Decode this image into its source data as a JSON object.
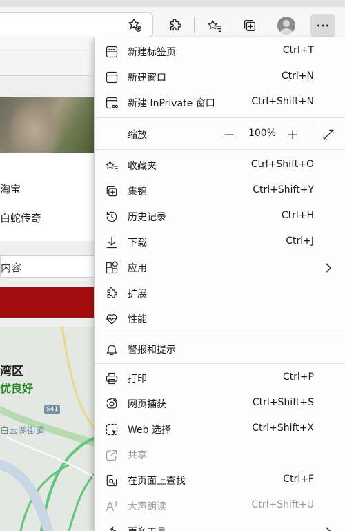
{
  "toolbar": {
    "icons": [
      "add-favorite-icon",
      "extensions-icon",
      "favorites-icon",
      "collections-icon",
      "profile-icon",
      "more-icon"
    ]
  },
  "page": {
    "line1": "淘宝",
    "line2": "白蛇传奇",
    "search_text": "内容",
    "map_title": "湾区",
    "map_status": "优良好",
    "map_road": "白云湖街道",
    "map_badge": "S41"
  },
  "menu": {
    "new_tab": {
      "label": "新建标签页",
      "shortcut": "Ctrl+T"
    },
    "new_window": {
      "label": "新建窗口",
      "shortcut": "Ctrl+N"
    },
    "new_inprivate": {
      "label": "新建 InPrivate 窗口",
      "shortcut": "Ctrl+Shift+N"
    },
    "zoom": {
      "label": "缩放",
      "value": "100%"
    },
    "favorites": {
      "label": "收藏夹",
      "shortcut": "Ctrl+Shift+O"
    },
    "collections": {
      "label": "集锦",
      "shortcut": "Ctrl+Shift+Y"
    },
    "history": {
      "label": "历史记录",
      "shortcut": "Ctrl+H"
    },
    "downloads": {
      "label": "下载",
      "shortcut": "Ctrl+J"
    },
    "apps": {
      "label": "应用"
    },
    "extensions": {
      "label": "扩展"
    },
    "performance": {
      "label": "性能"
    },
    "alerts": {
      "label": "警报和提示"
    },
    "print": {
      "label": "打印",
      "shortcut": "Ctrl+P"
    },
    "web_capture": {
      "label": "网页捕获",
      "shortcut": "Ctrl+Shift+S"
    },
    "web_select": {
      "label": "Web 选择",
      "shortcut": "Ctrl+Shift+X"
    },
    "share": {
      "label": "共享"
    },
    "find": {
      "label": "在页面上查找",
      "shortcut": "Ctrl+F"
    },
    "read_aloud": {
      "label": "大声朗读",
      "shortcut": "Ctrl+Shift+U"
    },
    "more_tools": {
      "label": "更多工具"
    }
  }
}
